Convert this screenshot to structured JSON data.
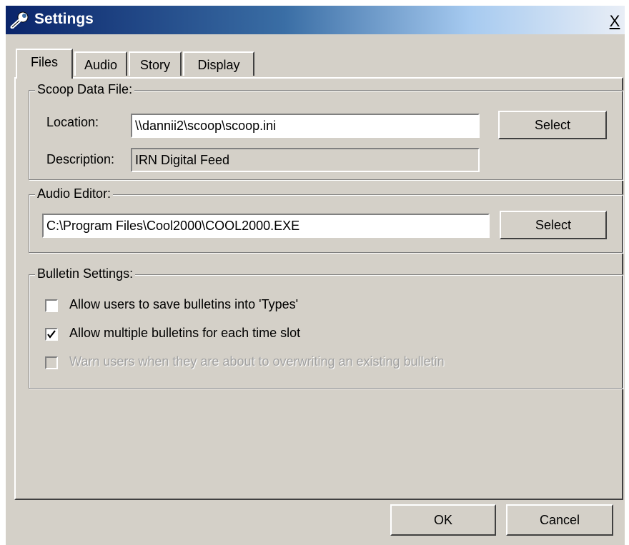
{
  "window": {
    "title": "Settings",
    "close_glyph": "X",
    "icon": "wrench-icon"
  },
  "tabs": [
    {
      "label": "Files",
      "active": true
    },
    {
      "label": "Audio",
      "active": false
    },
    {
      "label": "Story",
      "active": false
    },
    {
      "label": "Display",
      "active": false
    }
  ],
  "scoop_data_file": {
    "group_label": "Scoop Data File:",
    "location_label": "Location:",
    "location_value": "\\\\dannii2\\scoop\\scoop.ini",
    "select_label": "Select",
    "description_label": "Description:",
    "description_value": "IRN Digital Feed"
  },
  "audio_editor": {
    "group_label": "Audio Editor:",
    "path_value": "C:\\Program Files\\Cool2000\\COOL2000.EXE",
    "select_label": "Select"
  },
  "bulletin_settings": {
    "group_label": "Bulletin Settings:",
    "options": [
      {
        "label": "Allow users to save bulletins into 'Types'",
        "checked": false,
        "enabled": true
      },
      {
        "label": "Allow multiple bulletins for each time slot",
        "checked": true,
        "enabled": true
      },
      {
        "label": "Warn users when they are about to overwriting an existing bulletin",
        "checked": false,
        "enabled": false
      }
    ]
  },
  "footer": {
    "ok_label": "OK",
    "cancel_label": "Cancel"
  }
}
